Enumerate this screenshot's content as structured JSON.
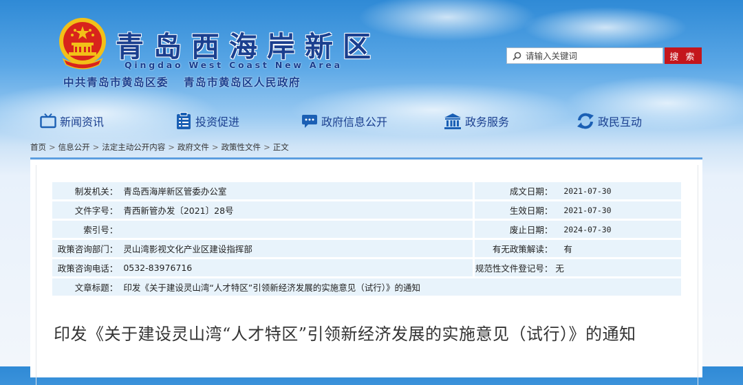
{
  "header": {
    "title": "青岛西海岸新区",
    "subtitle": "Qingdao West Coast New Area",
    "org_left": "中共青岛市黄岛区委",
    "org_right": "青岛市黄岛区人民政府"
  },
  "search": {
    "placeholder": "请输入关键词",
    "button": "搜 索"
  },
  "nav": [
    {
      "label": "新闻资讯",
      "icon": "tv-icon"
    },
    {
      "label": "投资促进",
      "icon": "clipboard-icon"
    },
    {
      "label": "政府信息公开",
      "icon": "chat-bubble-icon"
    },
    {
      "label": "政务服务",
      "icon": "government-building-icon"
    },
    {
      "label": "政民互动",
      "icon": "refresh-arrows-icon"
    }
  ],
  "breadcrumb": [
    "首页",
    "信息公开",
    "法定主动公开内容",
    "政府文件",
    "政策性文件",
    "正文"
  ],
  "meta": {
    "issuer_label": "制发机关：",
    "issuer": "青岛西海岸新区管委办公室",
    "doc_no_label": "文件字号：",
    "doc_no": "青西新管办发〔2021〕28号",
    "index_label": "索引号：",
    "index": "",
    "dept_label": "政策咨询部门：",
    "dept": "灵山湾影视文化产业区建设指挥部",
    "phone_label": "政策咨询电话：",
    "phone": "0532-83976716",
    "subject_label": "文章标题：",
    "subject": "印发《关于建设灵山湾“人才特区”引领新经济发展的实施意见（试行）》的通知",
    "created_label": "成文日期：",
    "created": "2021-07-30",
    "effective_label": "生效日期：",
    "effective": "2021-07-30",
    "expire_label": "废止日期：",
    "expire": "2024-07-30",
    "interp_label": "有无政策解读：",
    "interp": "有",
    "reg_label": "规范性文件登记号：",
    "reg": "无"
  },
  "doc_title": "印发《关于建设灵山湾“人才特区”引领新经济发展的实施意见（试行）》的通知",
  "colors": {
    "brand_blue": "#1a3f8f",
    "search_red": "#c4161c",
    "row_bg": "#e8f3fb",
    "panel_top": "#5b9ee0"
  }
}
